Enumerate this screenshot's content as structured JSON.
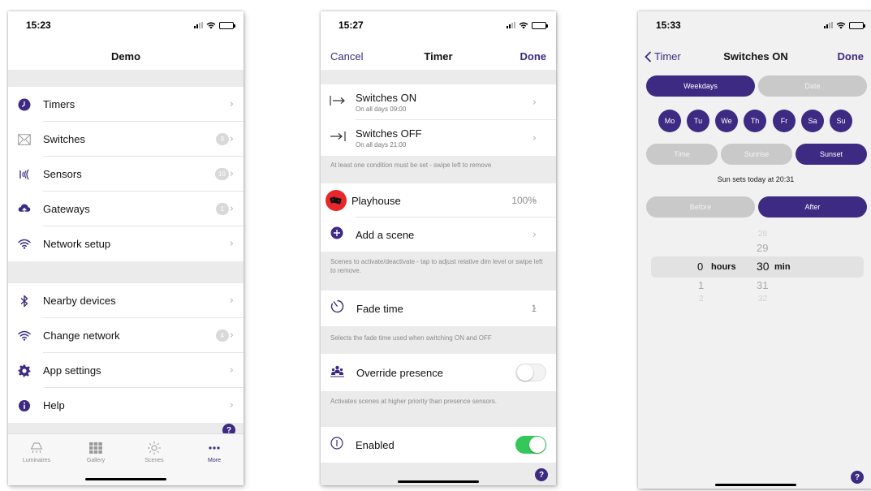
{
  "screen1": {
    "time": "15:23",
    "title": "Demo",
    "items": [
      {
        "label": "Timers",
        "icon": "clock-icon",
        "badge": ""
      },
      {
        "label": "Switches",
        "icon": "switch-envelope-icon",
        "badge": "9"
      },
      {
        "label": "Sensors",
        "icon": "sensor-waves-icon",
        "badge": "10"
      },
      {
        "label": "Gateways",
        "icon": "cloud-upload-icon",
        "badge": "1"
      },
      {
        "label": "Network setup",
        "icon": "wifi-icon",
        "badge": ""
      },
      {
        "label": "Nearby devices",
        "icon": "bluetooth-icon",
        "badge": ""
      },
      {
        "label": "Change network",
        "icon": "wifi-icon",
        "badge": "4"
      },
      {
        "label": "App settings",
        "icon": "gear-icon",
        "badge": ""
      },
      {
        "label": "Help",
        "icon": "info-icon",
        "badge": ""
      }
    ],
    "tabs": [
      {
        "label": "Luminaires",
        "icon": "luminaire-icon"
      },
      {
        "label": "Gallery",
        "icon": "gallery-grid-icon"
      },
      {
        "label": "Scenes",
        "icon": "scenes-sun-icon"
      },
      {
        "label": "More",
        "icon": "more-dots-icon"
      }
    ],
    "help": "?"
  },
  "screen2": {
    "time": "15:27",
    "cancel": "Cancel",
    "title": "Timer",
    "done": "Done",
    "switches_on": {
      "label": "Switches ON",
      "sub": "On all days  09:00"
    },
    "switches_off": {
      "label": "Switches OFF",
      "sub": "On all days  21:00"
    },
    "note_conditions": "At least one condition must be set - swipe left to remove",
    "playhouse": {
      "label": "Playhouse",
      "value": "100%"
    },
    "add_scene": "Add a scene",
    "note_scenes": "Scenes to activate/deactivate - tap to adjust relative dim level or swipe left to remove.",
    "fade": {
      "label": "Fade time",
      "value": "1"
    },
    "note_fade": "Selects the fade time used when switching ON and OFF",
    "override": {
      "label": "Override presence",
      "on": false
    },
    "note_override": "Activates scenes at higher priority than presence sensors.",
    "enabled": {
      "label": "Enabled",
      "on": true
    },
    "help": "?"
  },
  "screen3": {
    "time": "15:33",
    "back": "Timer",
    "title": "Switches ON",
    "done": "Done",
    "mode_tabs": [
      {
        "label": "Weekdays",
        "selected": true
      },
      {
        "label": "Date",
        "selected": false
      }
    ],
    "days": [
      "Mo",
      "Tu",
      "We",
      "Th",
      "Fr",
      "Sa",
      "Su"
    ],
    "trigger_tabs": [
      {
        "label": "Time",
        "selected": false
      },
      {
        "label": "Sunrise",
        "selected": false
      },
      {
        "label": "Sunset",
        "selected": true
      }
    ],
    "sun_info": "Sun sets today at 20:31",
    "offset_tabs": [
      {
        "label": "Before",
        "selected": false
      },
      {
        "label": "After",
        "selected": true
      }
    ],
    "picker": {
      "hours_above": "",
      "hours_selected": "0",
      "hours_unit": "hours",
      "hours_below": "1",
      "hours_below2": "2",
      "minutes_above2": "28",
      "minutes_above": "29",
      "minutes_selected": "30",
      "minutes_unit": "min",
      "minutes_below": "31",
      "minutes_below2": "32"
    },
    "help": "?"
  },
  "colors": {
    "accent": "#3d2a82",
    "toggle_on": "#34c759",
    "playhouse_red": "#e8262b",
    "section_gray": "#ebebeb"
  }
}
